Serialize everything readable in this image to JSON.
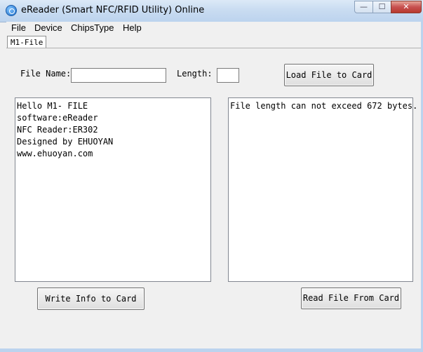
{
  "window": {
    "title": "eReader (Smart NFC/RFID Utility) Online",
    "controls": {
      "minimize": "—",
      "maximize": "☐",
      "close": "✕"
    }
  },
  "menu": {
    "file": "File",
    "device": "Device",
    "chips_type": "ChipsType",
    "help": "Help"
  },
  "tab": {
    "label": "M1-File"
  },
  "form": {
    "file_name_label": "File Name:",
    "file_name_value": "",
    "length_label": "Length:",
    "length_value": "",
    "load_button": "Load File to Card"
  },
  "left_text": {
    "lines": [
      "Hello M1- FILE",
      "software:eReader",
      "NFC Reader:ER302",
      "Designed by EHUOYAN",
      "www.ehuoyan.com"
    ]
  },
  "right_text": {
    "lines": [
      "File length can not exceed 672 bytes."
    ]
  },
  "buttons": {
    "write": "Write Info to Card",
    "read": "Read File From Card"
  }
}
